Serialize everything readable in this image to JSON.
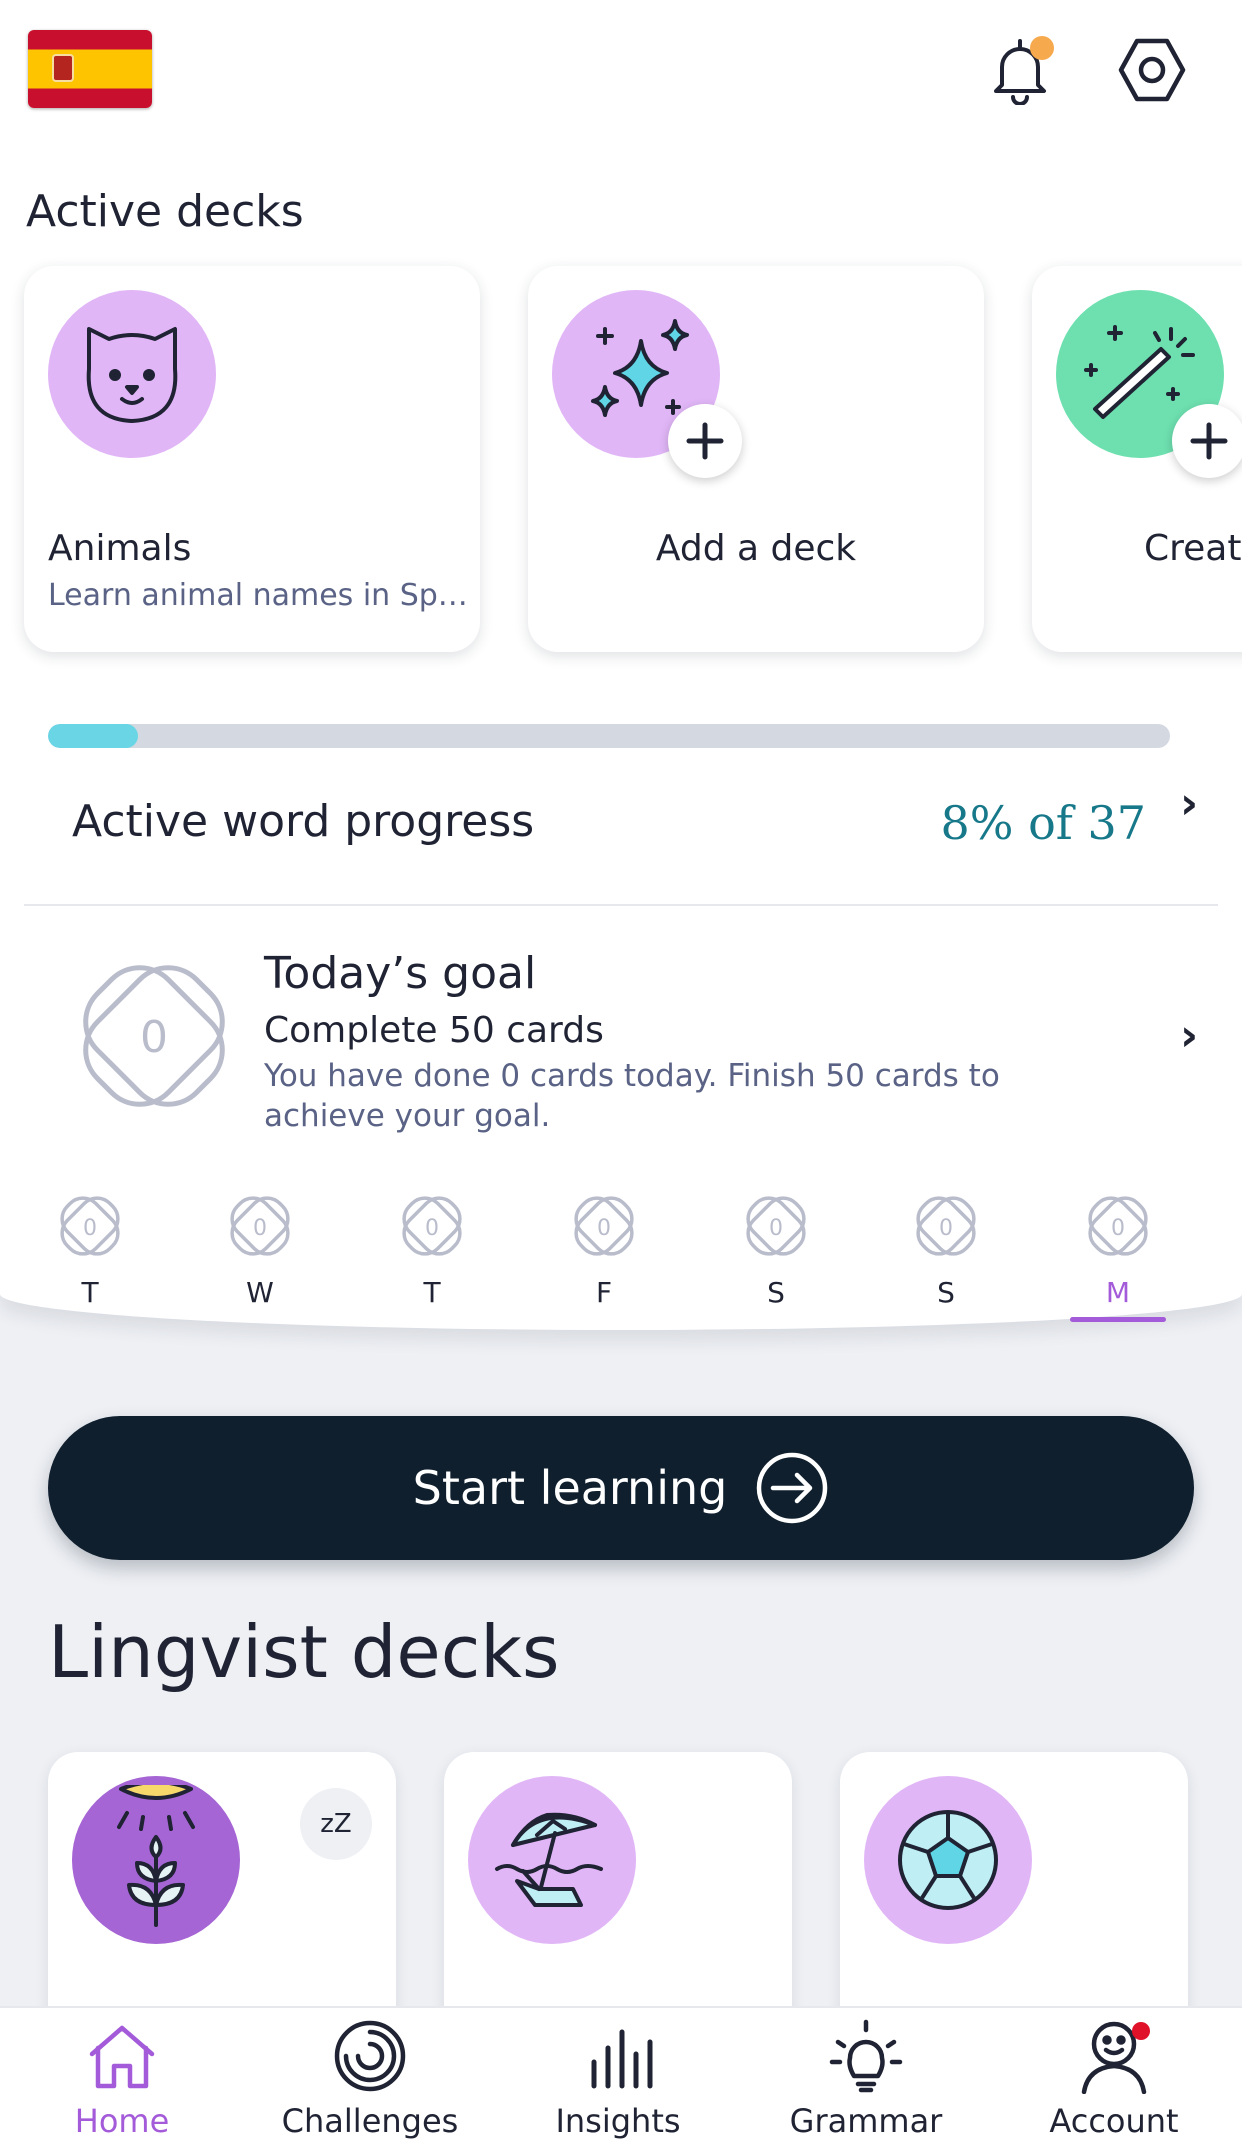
{
  "header": {
    "flag_icon": "spain-flag-icon",
    "notification_icon": "bell-icon",
    "settings_icon": "hexagon-settings-icon",
    "notification_dot_color": "#f6a94d"
  },
  "active_decks": {
    "title": "Active decks",
    "cards": [
      {
        "name": "Animals",
        "subtitle": "Learn animal names in Sp…",
        "icon": "cat-icon"
      },
      {
        "name": "Add a deck",
        "icon": "sparkles-icon"
      },
      {
        "name": "Create",
        "icon": "magic-wand-icon"
      }
    ]
  },
  "word_progress": {
    "label": "Active word progress",
    "value": "8% of 37",
    "fraction": 0.08
  },
  "goal": {
    "title": "Today’s goal",
    "subtitle": "Complete 50 cards",
    "description": "You have done 0 cards today. Finish 50 cards to achieve your goal.",
    "count": "0",
    "days": [
      {
        "letter": "T",
        "count": "0"
      },
      {
        "letter": "W",
        "count": "0"
      },
      {
        "letter": "T",
        "count": "0"
      },
      {
        "letter": "F",
        "count": "0"
      },
      {
        "letter": "S",
        "count": "0"
      },
      {
        "letter": "S",
        "count": "0"
      },
      {
        "letter": "M",
        "count": "0",
        "today": true
      }
    ]
  },
  "start_button": {
    "label": "Start learning"
  },
  "lingvist_decks": {
    "title": "Lingvist decks",
    "snooze_label": "zZ"
  },
  "nav": {
    "items": [
      {
        "label": "Home",
        "icon": "home-icon",
        "active": true
      },
      {
        "label": "Challenges",
        "icon": "challenges-icon"
      },
      {
        "label": "Insights",
        "icon": "insights-icon"
      },
      {
        "label": "Grammar",
        "icon": "lightbulb-icon"
      },
      {
        "label": "Account",
        "icon": "account-icon"
      }
    ]
  },
  "colors": {
    "accent": "#a45bd9",
    "progress": "#6ad6e5",
    "button": "#0f1f2e",
    "teal_text": "#17788a"
  }
}
